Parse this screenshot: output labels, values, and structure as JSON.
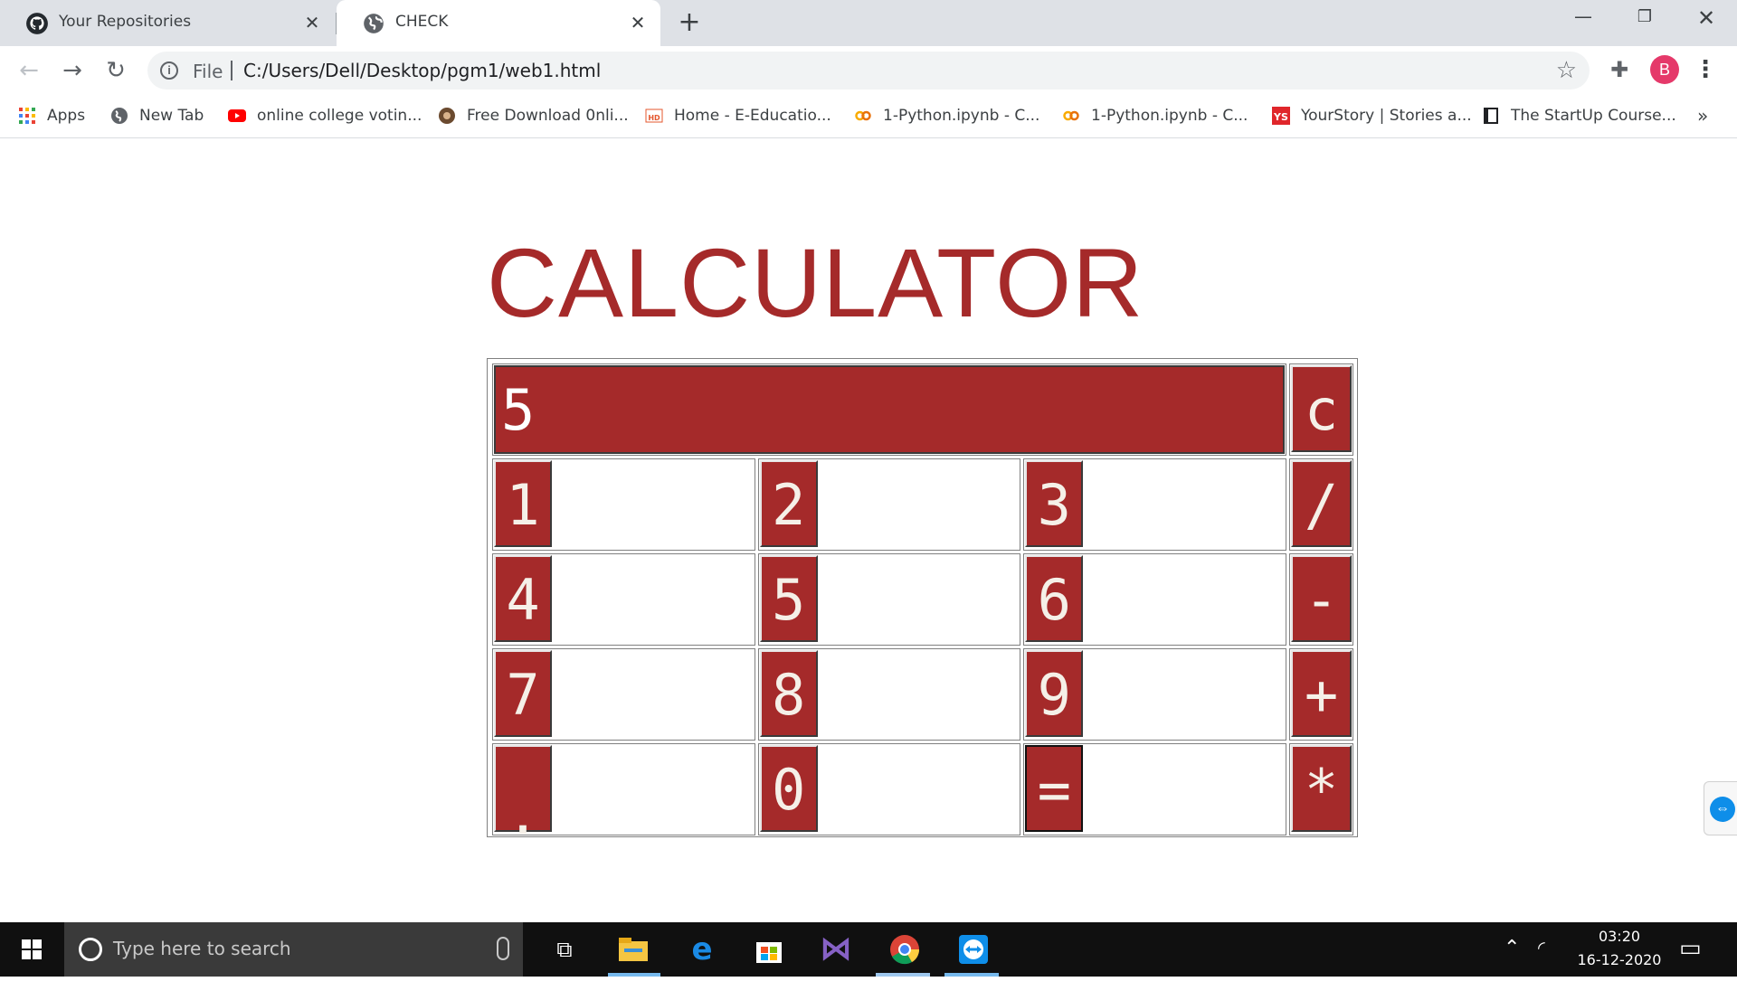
{
  "browser": {
    "tabs": [
      {
        "title": "Your Repositories",
        "icon": "github-icon",
        "active": false
      },
      {
        "title": "CHECK",
        "icon": "globe-icon",
        "active": true
      }
    ],
    "new_tab_glyph": "+",
    "address": {
      "scheme_label": "File",
      "url": "C:/Users/Dell/Desktop/pgm1/web1.html"
    },
    "profile_initial": "B",
    "bookmarks": [
      {
        "label": "Apps",
        "icon": "apps-grid-icon"
      },
      {
        "label": "New Tab",
        "icon": "globe-icon"
      },
      {
        "label": "online college votin...",
        "icon": "youtube-icon"
      },
      {
        "label": "Free Download 0nli...",
        "icon": "site-icon"
      },
      {
        "label": "Home - E-Educatio...",
        "icon": "hd-icon"
      },
      {
        "label": "1-Python.ipynb - C...",
        "icon": "colab-icon"
      },
      {
        "label": "1-Python.ipynb - C...",
        "icon": "colab-icon"
      },
      {
        "label": "YourStory | Stories a...",
        "icon": "yourstory-icon"
      },
      {
        "label": "The StartUp Course...",
        "icon": "book-icon"
      }
    ],
    "bookmark_overflow": "»"
  },
  "page": {
    "title": "CALCULATOR",
    "display_value": "5",
    "keys": {
      "clear": "c",
      "rows": [
        [
          "1",
          "2",
          "3",
          "/"
        ],
        [
          "4",
          "5",
          "6",
          "-"
        ],
        [
          "7",
          "8",
          "9",
          "+"
        ],
        [
          ".",
          "0",
          "=",
          "*"
        ]
      ]
    },
    "accent_color": "#a52a2a"
  },
  "taskbar": {
    "search_placeholder": "Type here to search",
    "time": "03:20",
    "date": "16-12-2020"
  }
}
